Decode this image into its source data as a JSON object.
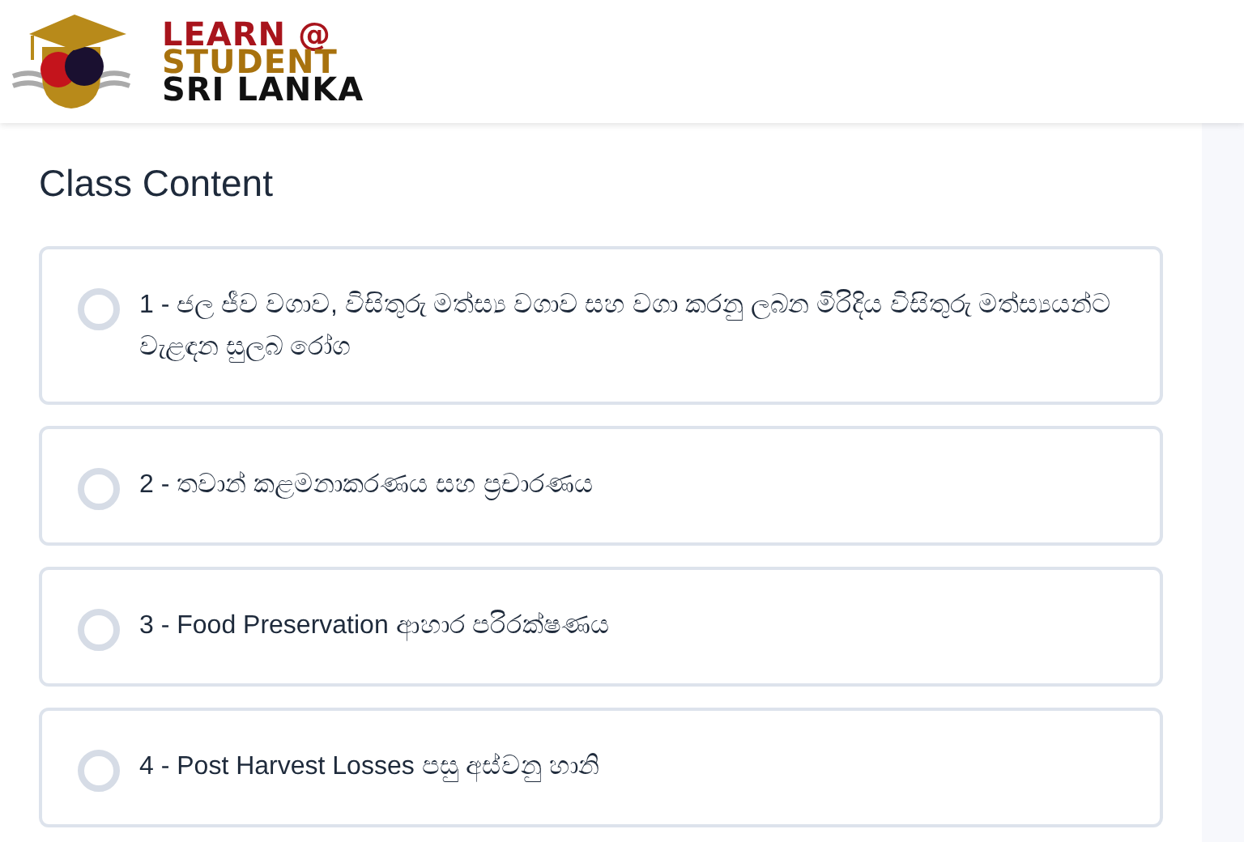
{
  "logo": {
    "lines": [
      "LEARN @",
      "STUDENT",
      "SRI LANKA"
    ]
  },
  "title": "Class Content",
  "lessons": [
    {
      "label": "1 - ජල ජීව වගාව, විසිතුරු මත්ස්‍ය වගාව සහ වගා කරනු ලබන මිරිදිය විසිතුරු මත්ස්‍යයන්ට වැළඳන සුලබ රෝග",
      "checked": false
    },
    {
      "label": "2 - තවාන් කළමනාකරණය සහ ප්‍රචාරණය",
      "checked": false
    },
    {
      "label": "3 - Food Preservation ආහාර පරිරක්ෂණය",
      "checked": false
    },
    {
      "label": "4 - Post Harvest Losses පසු අස්වනු හානි",
      "checked": false
    }
  ]
}
